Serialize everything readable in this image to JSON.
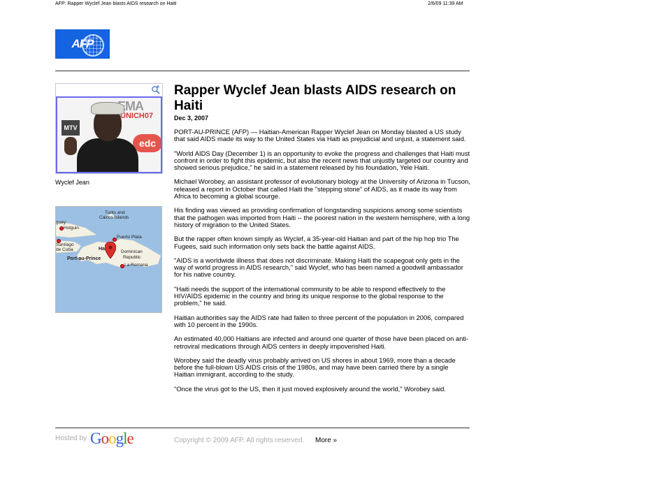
{
  "print_header": {
    "title": "AFP: Rapper Wyclef Jean blasts AIDS research on Haiti",
    "datetime": "2/6/09 11:39 AM"
  },
  "logo": {
    "text": "AFP"
  },
  "photo": {
    "caption": "Wyclef Jean",
    "overlay_text_1": "EMA",
    "overlay_text_2": "UNICH07",
    "overlay_text_3": "edc",
    "overlay_text_4": "MTV"
  },
  "map": {
    "labels": {
      "turks": "Turks and",
      "caicos": "Caicos Islands",
      "guey": "guey",
      "holguin": "Holguin",
      "puerto_plata": "Puerto Plata",
      "santiago": "Santiago",
      "de_cuba": "de Cuba",
      "haiti": "Ha",
      "dominican": "Dominican",
      "republic": "Republic",
      "port_au_prince": "Port-au-Prince",
      "la_romana": "La Romana"
    },
    "land_color": "#f3f0e4",
    "water_color": "#9cc0e4",
    "marker_color": "#d9302a"
  },
  "article": {
    "headline": "Rapper Wyclef Jean blasts AIDS research on Haiti",
    "date": "Dec 3, 2007",
    "paragraphs": [
      "PORT-AU-PRINCE (AFP) — Haitian-American Rapper Wyclef Jean on Monday blasted a US study that said AIDS made its way to the United States via Haiti as prejudicial and unjust, a statement said.",
      "\"World AIDS Day (December 1) is an opportunity to evoke the progress and challenges that Haiti must confront in order to fight this epidemic, but also the recent news that unjustly targeted our country and showed serious prejudice,\" he said in a statement released by his foundation, Yele Haiti.",
      "Michael Worobey, an assistant professor of evolutionary biology at the University of Arizona in Tucson, released a report in October that called Haiti the \"stepping stone\" of AIDS, as it made its way from Africa to becoming a global scourge.",
      "His finding was viewed as providing confirmation of longstanding suspicions among some scientists that the pathogen was imported from Haiti -- the poorest nation in the western hemisphere, with a long history of migration to the United States.",
      "But the rapper often known simply as Wyclef, a 35-year-old Haitian and part of the hip hop trio The Fugees, said such information only sets back the battle against AIDS.",
      "\"AIDS is a worldwide illness that does not discriminate. Making Haiti the scapegoat only gets in the way of world progress in AIDS research,\" said Wyclef, who has been named a goodwill ambassador for his native country.",
      "\"Haiti needs the support of the international community to be able to respond effectively to the HIV/AIDS epidemic in the country and bring its unique response to the global response to the problem,\" he said.",
      "Haitian authorities say the AIDS rate had fallen to three percent of the population in 2006, compared with 10 percent in the 1990s.",
      "An estimated 40,000 Haitians are infected and around one quarter of those have been placed on anti-retroviral medications through AIDS centers in deeply impoverished Haiti.",
      "Worobey said the deadly virus probably arrived on US shores in about 1969, more than a decade before the full-blown US AIDS crisis of the 1980s, and may have been carried there by a single Haitian immigrant, according to the study.",
      "\"Once the virus got to the US, then it just moved explosively around the world,\" Worobey said."
    ]
  },
  "footer": {
    "hosted_by": "Hosted by",
    "google": [
      "G",
      "o",
      "o",
      "g",
      "l",
      "e"
    ],
    "copyright": "Copyright © 2009 AFP. All rights reserved.",
    "more": "More »"
  }
}
